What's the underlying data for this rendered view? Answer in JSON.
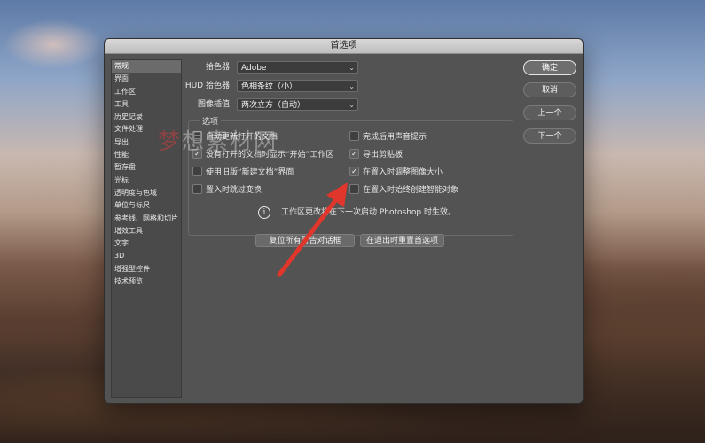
{
  "window": {
    "title": "首选项"
  },
  "sidebar": {
    "items": [
      {
        "label": "常规",
        "active": true
      },
      {
        "label": "界面"
      },
      {
        "label": "工作区"
      },
      {
        "label": "工具"
      },
      {
        "label": "历史记录"
      },
      {
        "label": "文件处理"
      },
      {
        "label": "导出"
      },
      {
        "label": "性能"
      },
      {
        "label": "暂存盘"
      },
      {
        "label": "光标"
      },
      {
        "label": "透明度与色域"
      },
      {
        "label": "单位与标尺"
      },
      {
        "label": "参考线、网格和切片"
      },
      {
        "label": "增效工具"
      },
      {
        "label": "文字"
      },
      {
        "label": "3D"
      },
      {
        "label": "增强型控件"
      },
      {
        "label": "技术预览"
      }
    ]
  },
  "general": {
    "color_picker": {
      "label": "拾色器:",
      "value": "Adobe"
    },
    "hud_picker": {
      "label": "HUD 拾色器:",
      "value": "色相条纹（小）"
    },
    "interpolation": {
      "label": "图像插值:",
      "value": "两次立方（自动）"
    }
  },
  "options": {
    "title": "选项",
    "left": [
      {
        "label": "自动更新打开的文档",
        "checked": false
      },
      {
        "label": "没有打开的文档时显示“开始”工作区",
        "checked": true
      },
      {
        "label": "使用旧版“新建文档”界面",
        "checked": false
      },
      {
        "label": "置入时跳过变换",
        "checked": false
      }
    ],
    "right": [
      {
        "label": "完成后用声音提示",
        "checked": false
      },
      {
        "label": "导出剪贴板",
        "checked": true
      },
      {
        "label": "在置入时调整图像大小",
        "checked": true
      },
      {
        "label": "在置入时始终创建智能对象",
        "checked": false
      }
    ],
    "info_text": "工作区更改将在下一次启动 Photoshop 时生效。"
  },
  "bottom_buttons": {
    "reset_dialogs": "复位所有警告对话框",
    "reset_prefs": "在退出时重置首选项"
  },
  "right_buttons": {
    "ok": "确定",
    "cancel": "取消",
    "prev": "上一个",
    "next": "下一个"
  },
  "watermark": {
    "part1": "梦",
    "part2": "想素材网"
  },
  "colors": {
    "accent_red": "#e0362b",
    "panel": "#535353"
  }
}
